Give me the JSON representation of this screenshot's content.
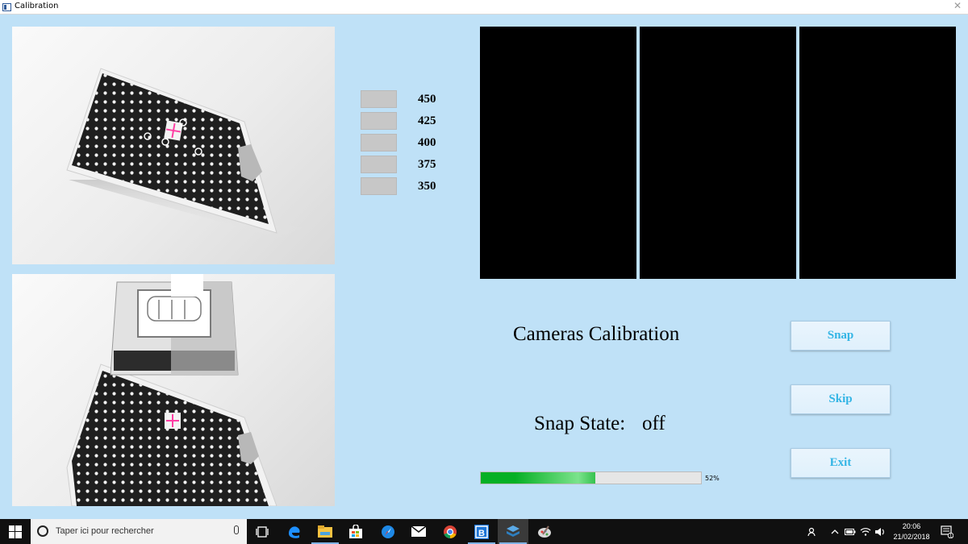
{
  "window": {
    "title": "Calibration",
    "close_glyph": "✕"
  },
  "distances": [
    {
      "label": "450"
    },
    {
      "label": "425"
    },
    {
      "label": "400"
    },
    {
      "label": "375"
    },
    {
      "label": "350"
    }
  ],
  "calibration_title": "Cameras Calibration",
  "snap_state": {
    "label": "Snap State:",
    "value": "off"
  },
  "buttons": {
    "snap": "Snap",
    "skip": "Skip",
    "exit": "Exit"
  },
  "progress": {
    "percent": 52,
    "text": "52%"
  },
  "taskbar": {
    "search_placeholder": "Taper ici pour rechercher",
    "clock_time": "20:06",
    "clock_date": "21/02/2018",
    "notification_count": "1"
  },
  "colors": {
    "background": "#bfe1f7",
    "button_text": "#33b5e5",
    "progress_fill": "#06b025",
    "camera_view": "#000000"
  }
}
